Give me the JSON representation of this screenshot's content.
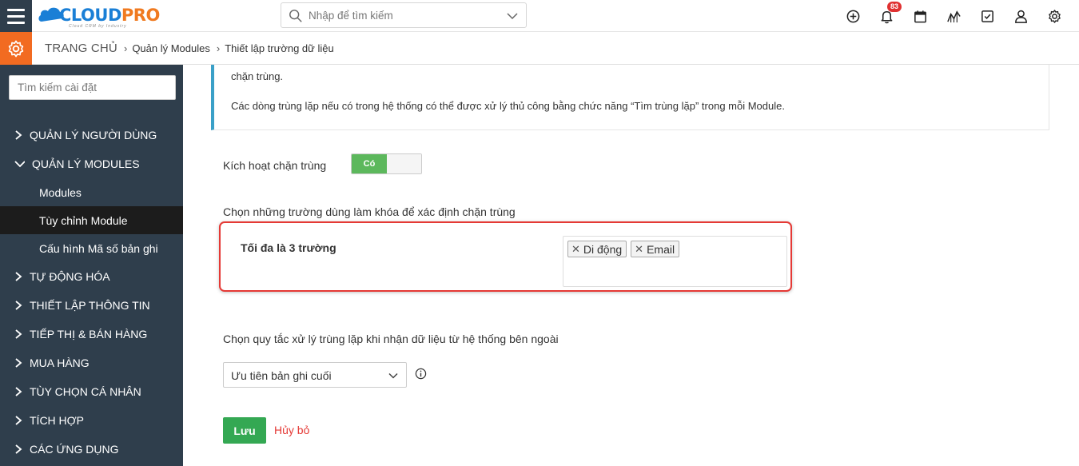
{
  "header": {
    "logo": {
      "part1": "CLOUD",
      "part2": "PRO",
      "tagline": "Cloud CRM by Industry"
    },
    "search": {
      "placeholder": "Nhập để tìm kiếm"
    },
    "notification_count": "83",
    "icons": [
      "plus-circle-icon",
      "bell-icon",
      "calendar-icon",
      "chart-icon",
      "checkbox-icon",
      "user-icon",
      "gear-icon"
    ]
  },
  "breadcrumb": {
    "home": "TRANG CHỦ",
    "items": [
      "Quản lý Modules",
      "Thiết lập trường dữ liệu"
    ]
  },
  "sidebar": {
    "search_placeholder": "Tìm kiếm cài đặt",
    "items": [
      {
        "label": "QUẢN LÝ NGƯỜI DÙNG",
        "expanded": false
      },
      {
        "label": "QUẢN LÝ MODULES",
        "expanded": true
      },
      {
        "label": "TỰ ĐỘNG HÓA",
        "expanded": false
      },
      {
        "label": "THIẾT LẬP THÔNG TIN",
        "expanded": false
      },
      {
        "label": "TIẾP THỊ & BÁN HÀNG",
        "expanded": false
      },
      {
        "label": "MUA HÀNG",
        "expanded": false
      },
      {
        "label": "TÙY CHỌN CÁ NHÂN",
        "expanded": false
      },
      {
        "label": "TÍCH HỢP",
        "expanded": false
      },
      {
        "label": "CÁC ỨNG DỤNG",
        "expanded": false
      }
    ],
    "subitems": [
      {
        "label": "Modules",
        "active": false
      },
      {
        "label": "Tùy chỉnh Module",
        "active": true
      },
      {
        "label": "Cấu hình Mã số bản ghi",
        "active": false
      }
    ]
  },
  "main": {
    "info_line1": "chặn trùng.",
    "info_line2": "Các dòng trùng lặp nếu có trong hệ thống có thể được xử lý thủ công bằng chức năng “Tìm trùng lặp” trong mỗi Module.",
    "activate_label": "Kích hoạt chặn trùng",
    "toggle_label": "Có",
    "toggle_on": true,
    "key_fields_title": "Chọn những trường dùng làm khóa để xác định chặn trùng",
    "max_fields": "Tối đa là 3 trường",
    "selected_fields": [
      "Di động",
      "Email"
    ],
    "rule_title": "Chọn quy tắc xử lý trùng lặp khi nhận dữ liệu từ hệ thống bên ngoài",
    "rule_value": "Ưu tiên bản ghi cuối",
    "save_label": "Lưu",
    "cancel_label": "Hủy bỏ"
  },
  "colors": {
    "sidebar_bg": "#2f3e4c",
    "accent_orange": "#f26b21",
    "save_green": "#34a853",
    "toggle_green": "#5cb85c",
    "highlight_red": "#e53935",
    "info_border": "#3aa0c8"
  }
}
